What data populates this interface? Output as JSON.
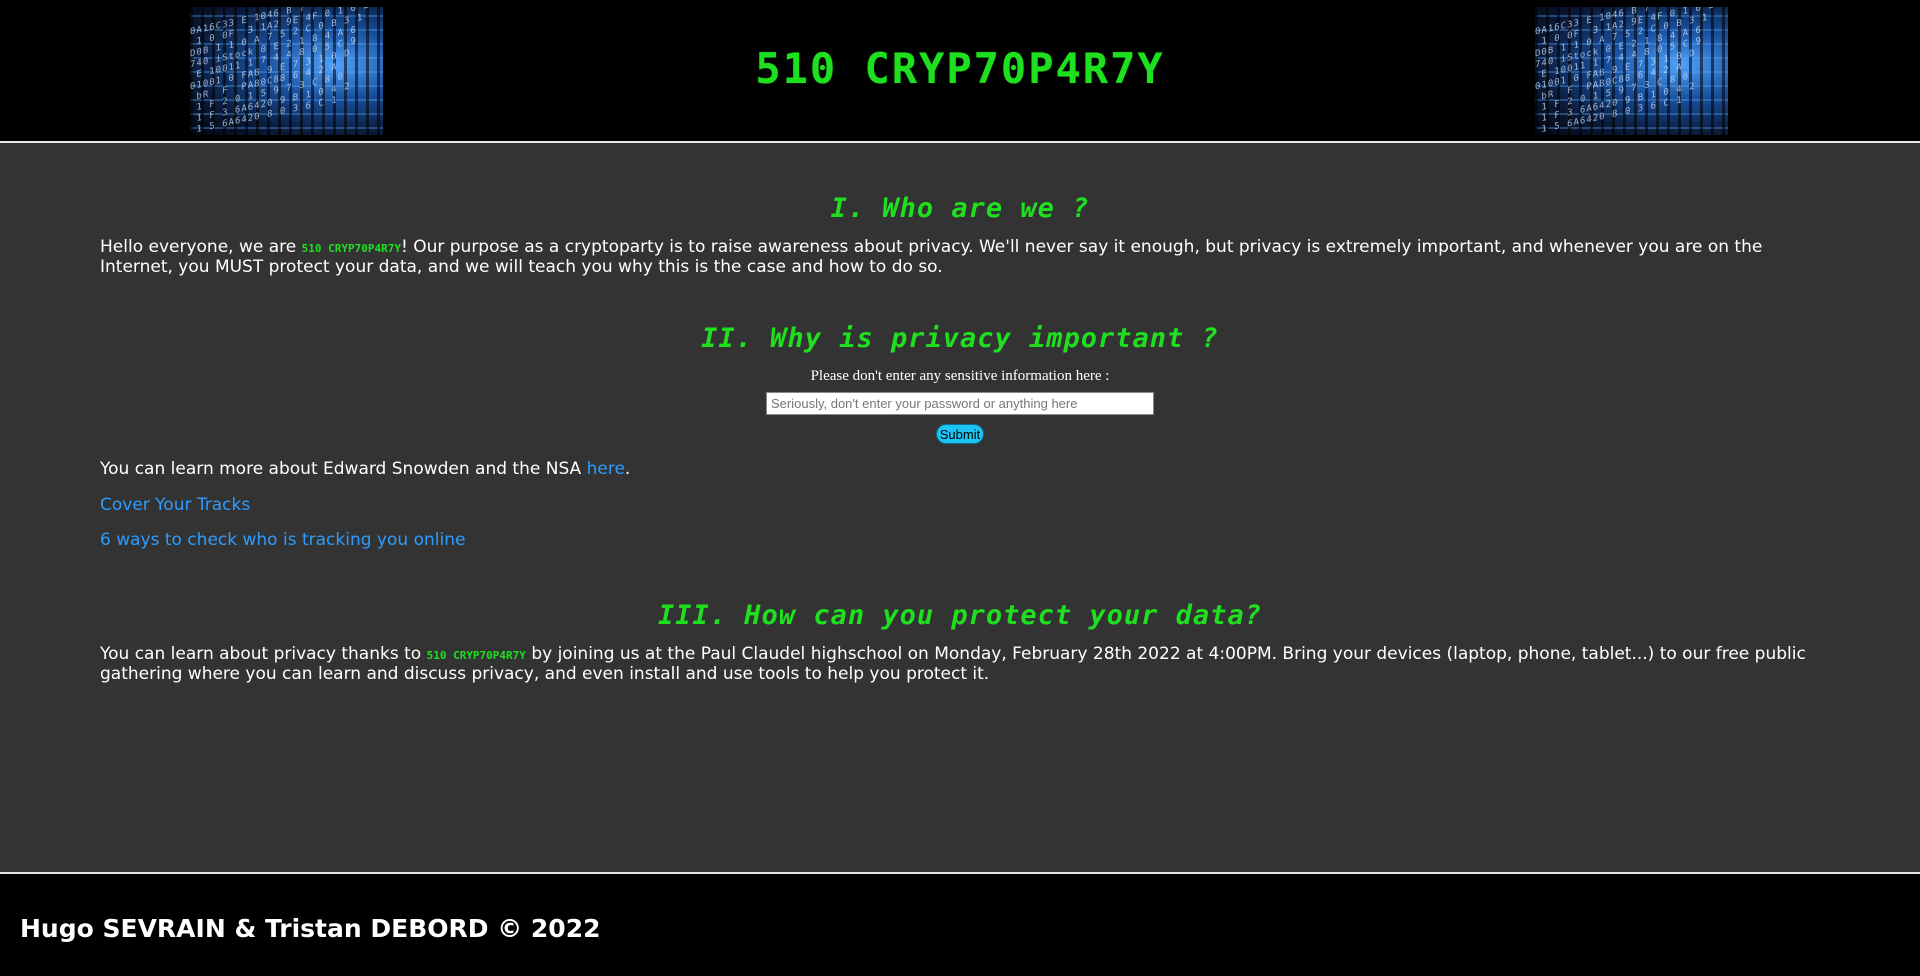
{
  "header": {
    "title": "510 CRYP70P4R7Y"
  },
  "sections": [
    {
      "heading": "I. Who are we ?",
      "text_before": "Hello everyone, we are ",
      "brand": "510 CRYP70P4R7Y",
      "text_after": "! Our purpose as a cryptoparty is to raise awareness about privacy. We'll never say it enough, but privacy is extremely important, and whenever you are on the Internet, you MUST protect your data, and we will teach you why this is the case and how to do so."
    },
    {
      "heading": "II. Why is privacy important ?",
      "form": {
        "label": "Please don't enter any sensitive information here :",
        "placeholder": "Seriously, don't enter your password or anything here",
        "value": "",
        "submit_label": "Submit"
      },
      "snowden_text": "You can learn more about Edward Snowden and the NSA ",
      "snowden_link": "here",
      "snowden_end": ".",
      "links": [
        "Cover Your Tracks",
        "6 ways to check who is tracking you online"
      ]
    },
    {
      "heading": "III. How can you protect your data?",
      "text_before": "You can learn about privacy thanks to ",
      "brand": "510 CRYP70P4R7Y",
      "text_after": " by joining us at the Paul Claudel highschool on Monday, February 28th 2022 at 4:00PM. Bring your devices (laptop, phone, tablet...) to our free public gathering where you can learn and discuss privacy, and even install and use tools to help you protect it."
    }
  ],
  "footer": {
    "text": "Hugo SEVRAIN & Tristan DEBORD © 2022"
  },
  "colors": {
    "accent_green": "#1fe01f",
    "link_blue": "#2d9cff",
    "background": "#333333",
    "header_bg": "#000000",
    "button": "#1cc3f3"
  }
}
